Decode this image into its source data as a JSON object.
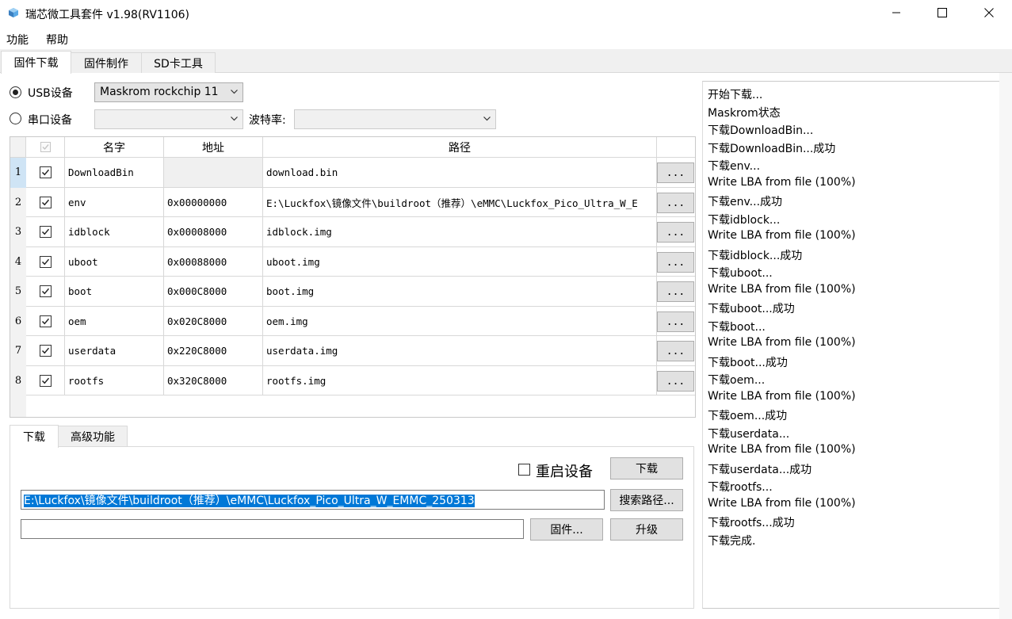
{
  "window": {
    "title": "瑞芯微工具套件 v1.98(RV1106)"
  },
  "menu": [
    "功能",
    "帮助"
  ],
  "tabs": [
    {
      "label": "固件下载",
      "active": true
    },
    {
      "label": "固件制作",
      "active": false
    },
    {
      "label": "SD卡工具",
      "active": false
    }
  ],
  "device": {
    "usb_label": "USB设备",
    "usb_value": "Maskrom rockchip 11",
    "serial_label": "串口设备",
    "serial_value": "",
    "baud_label": "波特率:",
    "baud_value": ""
  },
  "table": {
    "headers": [
      "名字",
      "地址",
      "路径"
    ],
    "rows": [
      {
        "num": "1",
        "name": "DownloadBin",
        "address": "",
        "path": "download.bin",
        "checked": true
      },
      {
        "num": "2",
        "name": "env",
        "address": "0x00000000",
        "path": "E:\\Luckfox\\镜像文件\\buildroot（推荐）\\eMMC\\Luckfox_Pico_Ultra_W_E",
        "checked": true
      },
      {
        "num": "3",
        "name": "idblock",
        "address": "0x00008000",
        "path": "idblock.img",
        "checked": true
      },
      {
        "num": "4",
        "name": "uboot",
        "address": "0x00088000",
        "path": "uboot.img",
        "checked": true
      },
      {
        "num": "5",
        "name": "boot",
        "address": "0x000C8000",
        "path": "boot.img",
        "checked": true
      },
      {
        "num": "6",
        "name": "oem",
        "address": "0x020C8000",
        "path": "oem.img",
        "checked": true
      },
      {
        "num": "7",
        "name": "userdata",
        "address": "0x220C8000",
        "path": "userdata.img",
        "checked": true
      },
      {
        "num": "8",
        "name": "rootfs",
        "address": "0x320C8000",
        "path": "rootfs.img",
        "checked": true
      }
    ],
    "browse_label": "..."
  },
  "subtabs": [
    {
      "label": "下载",
      "active": true
    },
    {
      "label": "高级功能",
      "active": false
    }
  ],
  "download": {
    "reboot_label": "重启设备",
    "download_button": "下载",
    "path_value": "E:\\Luckfox\\镜像文件\\buildroot（推荐）\\eMMC\\Luckfox_Pico_Ultra_W_EMMC_250313",
    "search_path_button": "搜索路径...",
    "firmware_value": "",
    "firmware_button": "固件...",
    "upgrade_button": "升级"
  },
  "log": [
    "开始下载...",
    "Maskrom状态",
    "下载DownloadBin...",
    "下载DownloadBin...成功",
    "下载env...",
    "Write LBA from file (100%)",
    "下载env...成功",
    "下载idblock...",
    "Write LBA from file (100%)",
    "下载idblock...成功",
    "下载uboot...",
    "Write LBA from file (100%)",
    "下载uboot...成功",
    "下载boot...",
    "Write LBA from file (100%)",
    "下载boot...成功",
    "下载oem...",
    "Write LBA from file (100%)",
    "下载oem...成功",
    "下载userdata...",
    "Write LBA from file (100%)",
    "下载userdata...成功",
    "下载rootfs...",
    "Write LBA from file (100%)",
    "下载rootfs...成功",
    "下载完成."
  ]
}
